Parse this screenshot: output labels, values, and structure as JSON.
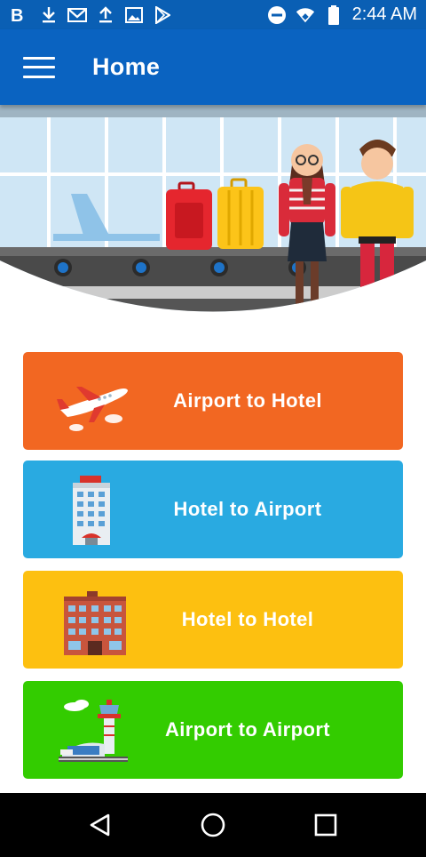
{
  "status_bar": {
    "left_icons": [
      "b-app-icon",
      "download-icon",
      "gmail-icon",
      "upload-icon",
      "image-icon",
      "play-store-icon"
    ],
    "right_icons": [
      "do-not-disturb-icon",
      "wifi-icon",
      "battery-icon"
    ],
    "time": "2:44 AM"
  },
  "app_bar": {
    "title": "Home",
    "menu_icon": "hamburger-menu-icon",
    "color": "#0a63c1"
  },
  "options": [
    {
      "label": "Airport to Hotel",
      "icon": "airplane-icon",
      "color": "#f26722"
    },
    {
      "label": "Hotel to Airport",
      "icon": "hotel-building-icon",
      "color": "#29aae1"
    },
    {
      "label": "Hotel to Hotel",
      "icon": "brick-hotel-icon",
      "color": "#fdc010"
    },
    {
      "label": "Airport to Airport",
      "icon": "control-tower-icon",
      "color": "#33cc00"
    }
  ],
  "nav_bar": {
    "buttons": [
      "back-icon",
      "home-icon",
      "recents-icon"
    ]
  }
}
